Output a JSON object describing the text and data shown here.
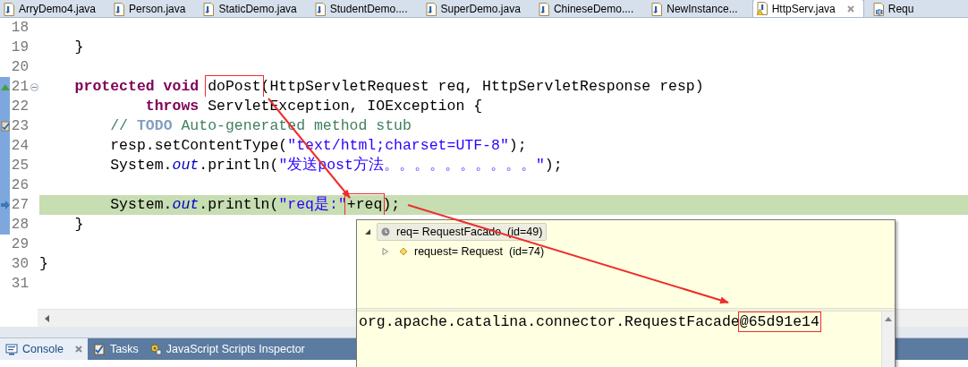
{
  "editor_tabs": [
    {
      "label": "ArryDemo4.java",
      "selected": false,
      "kind": "java"
    },
    {
      "label": "Person.java",
      "selected": false,
      "kind": "java"
    },
    {
      "label": "StaticDemo.java",
      "selected": false,
      "kind": "java"
    },
    {
      "label": "StudentDemo....",
      "selected": false,
      "kind": "java"
    },
    {
      "label": "SuperDemo.java",
      "selected": false,
      "kind": "java"
    },
    {
      "label": "ChineseDemo....",
      "selected": false,
      "kind": "java"
    },
    {
      "label": "NewInstance...",
      "selected": false,
      "kind": "java"
    },
    {
      "label": "HttpServ.java",
      "selected": true,
      "kind": "warning"
    },
    {
      "label": "Requ",
      "selected": false,
      "kind": "binary"
    }
  ],
  "code_lines": [
    {
      "number": "18",
      "override": false,
      "task": false,
      "in_range": false,
      "current": false
    },
    {
      "number": "19",
      "override": false,
      "task": false,
      "in_range": false,
      "current": false,
      "tokens": [
        {
          "text": "    }",
          "kind": "plain"
        }
      ]
    },
    {
      "number": "20",
      "override": false,
      "task": false,
      "in_range": false,
      "current": false
    },
    {
      "number": "21",
      "override": true,
      "task": false,
      "expanded": true,
      "in_range": true,
      "current": false,
      "tokens": [
        {
          "text": "    protected void ",
          "kind": "keyword"
        },
        {
          "text": "doPost",
          "kind": "plain",
          "boxed": true
        },
        {
          "text": "(HttpServletRequest req, HttpServletResponse resp)",
          "kind": "plain"
        }
      ]
    },
    {
      "number": "22",
      "override": false,
      "task": false,
      "in_range": true,
      "current": false,
      "tokens": [
        {
          "text": "            throws",
          "kind": "keyword"
        },
        {
          "text": " ServletException, IOException {",
          "kind": "plain"
        }
      ]
    },
    {
      "number": "23",
      "override": false,
      "task": true,
      "in_range": true,
      "current": false,
      "tokens": [
        {
          "text": "        // ",
          "kind": "comment"
        },
        {
          "text": "TODO",
          "kind": "todo"
        },
        {
          "text": " Auto-generated method stub",
          "kind": "comment"
        }
      ]
    },
    {
      "number": "24",
      "override": false,
      "task": false,
      "in_range": true,
      "current": false,
      "tokens": [
        {
          "text": "        resp.setContentType(",
          "kind": "plain"
        },
        {
          "text": "\"text/html;charset=UTF-8\"",
          "kind": "string"
        },
        {
          "text": ");",
          "kind": "plain"
        }
      ]
    },
    {
      "number": "25",
      "override": false,
      "task": false,
      "in_range": true,
      "current": false,
      "tokens": [
        {
          "text": "        System.",
          "kind": "plain"
        },
        {
          "text": "out",
          "kind": "static"
        },
        {
          "text": ".println(",
          "kind": "plain"
        },
        {
          "text": "\"发送post方法。。。。。。。。。。\"",
          "kind": "string"
        },
        {
          "text": ");",
          "kind": "plain"
        }
      ]
    },
    {
      "number": "26",
      "override": false,
      "task": false,
      "in_range": true,
      "current": false
    },
    {
      "number": "27",
      "override": false,
      "task": false,
      "in_range": true,
      "current": true,
      "tokens": [
        {
          "text": "        System.",
          "kind": "plain"
        },
        {
          "text": "out",
          "kind": "static"
        },
        {
          "text": ".println(",
          "kind": "plain"
        },
        {
          "text": "\"req是:\"",
          "kind": "string"
        },
        {
          "text": "+req",
          "kind": "plain",
          "boxed": true
        },
        {
          "text": ");",
          "kind": "plain"
        }
      ]
    },
    {
      "number": "28",
      "override": false,
      "task": false,
      "in_range": true,
      "current": false,
      "tokens": [
        {
          "text": "    }",
          "kind": "plain"
        }
      ]
    },
    {
      "number": "29",
      "override": false,
      "task": false,
      "in_range": false,
      "current": false
    },
    {
      "number": "30",
      "override": false,
      "task": false,
      "in_range": false,
      "current": false,
      "tokens": [
        {
          "text": "}",
          "kind": "plain"
        }
      ]
    },
    {
      "number": "31",
      "override": false,
      "task": false,
      "in_range": false,
      "current": false
    }
  ],
  "inspect_popup": {
    "variables": [
      {
        "text": "req= RequestFacade  (id=49)",
        "kind": "local",
        "expanded": true,
        "selected": true,
        "children": [
          {
            "text": "request= Request  (id=74)",
            "kind": "field",
            "expanded": false,
            "selected": false
          }
        ]
      }
    ],
    "detail": [
      {
        "text": "org.apache.catalina.connector.RequestFacade",
        "boxed": false
      },
      {
        "text": "@65d91e14",
        "boxed": true
      }
    ]
  },
  "panel_tabs": [
    {
      "label": "Console",
      "selected": true,
      "kind": "console"
    },
    {
      "label": "Tasks",
      "selected": false,
      "kind": "tasks"
    },
    {
      "label": "JavaScript Scripts Inspector",
      "selected": false,
      "kind": "javascript"
    }
  ]
}
